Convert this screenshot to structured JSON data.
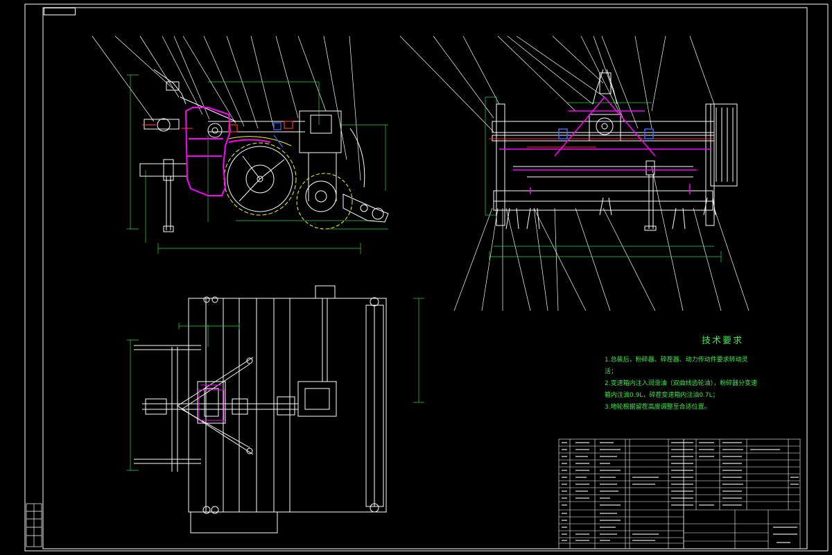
{
  "tech_requirements": {
    "title": "技术要求",
    "lines": [
      "1.总装后，粉碎器、碎茬器、动力传动件要求转动灵",
      "活；",
      "2.变速箱内注入润滑油（双曲线齿轮油），粉碎器分变速",
      "箱内注油0.9L，碎茬变速箱内注油0.7L；",
      "3.地轮根据留茬高度调整至合适位置。"
    ]
  },
  "colors": {
    "background": "#000000",
    "frame": "#ffffff",
    "dimension": "#22e04a",
    "part": "#ff00ff",
    "hatch": "#ffff00",
    "text_green": "#39e84a"
  }
}
